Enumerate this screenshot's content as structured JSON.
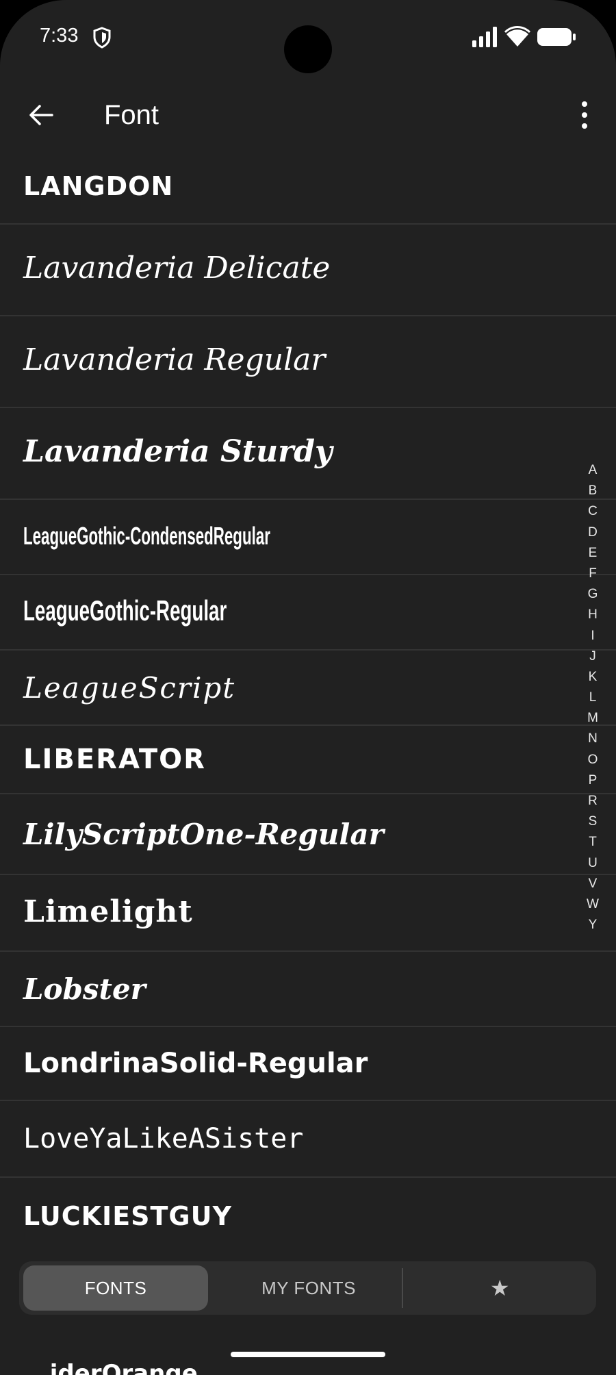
{
  "status_bar": {
    "time": "7:33"
  },
  "app_bar": {
    "title": "Font"
  },
  "fonts": [
    {
      "name": "LANGDON"
    },
    {
      "name": "Lavanderia Delicate"
    },
    {
      "name": "Lavanderia Regular"
    },
    {
      "name": "Lavanderia Sturdy"
    },
    {
      "name": "LeagueGothic-CondensedRegular"
    },
    {
      "name": "LeagueGothic-Regular"
    },
    {
      "name": "LeagueScript"
    },
    {
      "name": "LIBERATOR"
    },
    {
      "name": "LilyScriptOne-Regular"
    },
    {
      "name": "Limelight"
    },
    {
      "name": "Lobster"
    },
    {
      "name": "LondrinaSolid-Regular"
    },
    {
      "name": "LoveYaLikeASister"
    },
    {
      "name": "LUCKIESTGUY"
    },
    {
      "name": "...iderOrange"
    }
  ],
  "alphabet_index": [
    "A",
    "B",
    "C",
    "D",
    "E",
    "F",
    "G",
    "H",
    "I",
    "J",
    "K",
    "L",
    "M",
    "N",
    "O",
    "P",
    "R",
    "S",
    "T",
    "U",
    "V",
    "W",
    "Y"
  ],
  "tabs": {
    "fonts": "FONTS",
    "my_fonts": "MY FONTS",
    "favorites": "★"
  }
}
